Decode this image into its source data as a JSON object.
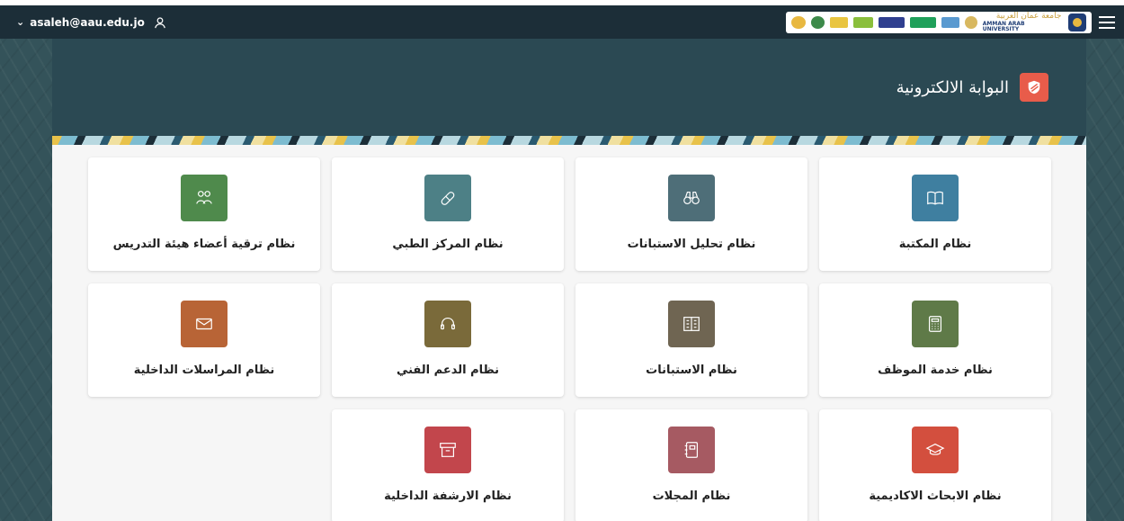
{
  "user": {
    "email": "asaleh@aau.edu.jo"
  },
  "header": {
    "university_ar": "جامعة عمان العربية",
    "university_en": "AMMAN ARAB UNIVERSITY"
  },
  "hero": {
    "title": "البوابة الالكترونية"
  },
  "colors": {
    "topbar": "#1c2e38",
    "hero_badge": "#e85c4a",
    "library": "#3f7fa0",
    "surveys_analysis": "#4e6e78",
    "medical": "#4d8086",
    "faculty_promotion": "#4f8a4c",
    "employee_service": "#5f7a48",
    "surveys": "#6f6552",
    "support": "#7a6a3a",
    "messages": "#b86436",
    "research": "#d34f3e",
    "journals": "#a65a62",
    "archive": "#c2464c"
  },
  "tiles": [
    {
      "label": "نظام المكتبة",
      "icon": "book-icon"
    },
    {
      "label": "نظام تحليل الاستبانات",
      "icon": "binoculars-icon"
    },
    {
      "label": "نظام المركز الطبي",
      "icon": "pill-icon"
    },
    {
      "label": "نظام ترقية أعضاء هيئة التدريس",
      "icon": "users-icon"
    },
    {
      "label": "نظام خدمة الموظف",
      "icon": "calculator-icon"
    },
    {
      "label": "نظام الاستبانات",
      "icon": "survey-icon"
    },
    {
      "label": "نظام الدعم الفني",
      "icon": "headset-icon"
    },
    {
      "label": "نظام المراسلات الداخلية",
      "icon": "mail-icon"
    },
    {
      "label": "نظام الابحاث الاكاديمية",
      "icon": "graduation-cap-icon"
    },
    {
      "label": "نظام المجلات",
      "icon": "notebook-icon"
    },
    {
      "label": "نظام الارشفة الداخلية",
      "icon": "archive-box-icon"
    }
  ]
}
